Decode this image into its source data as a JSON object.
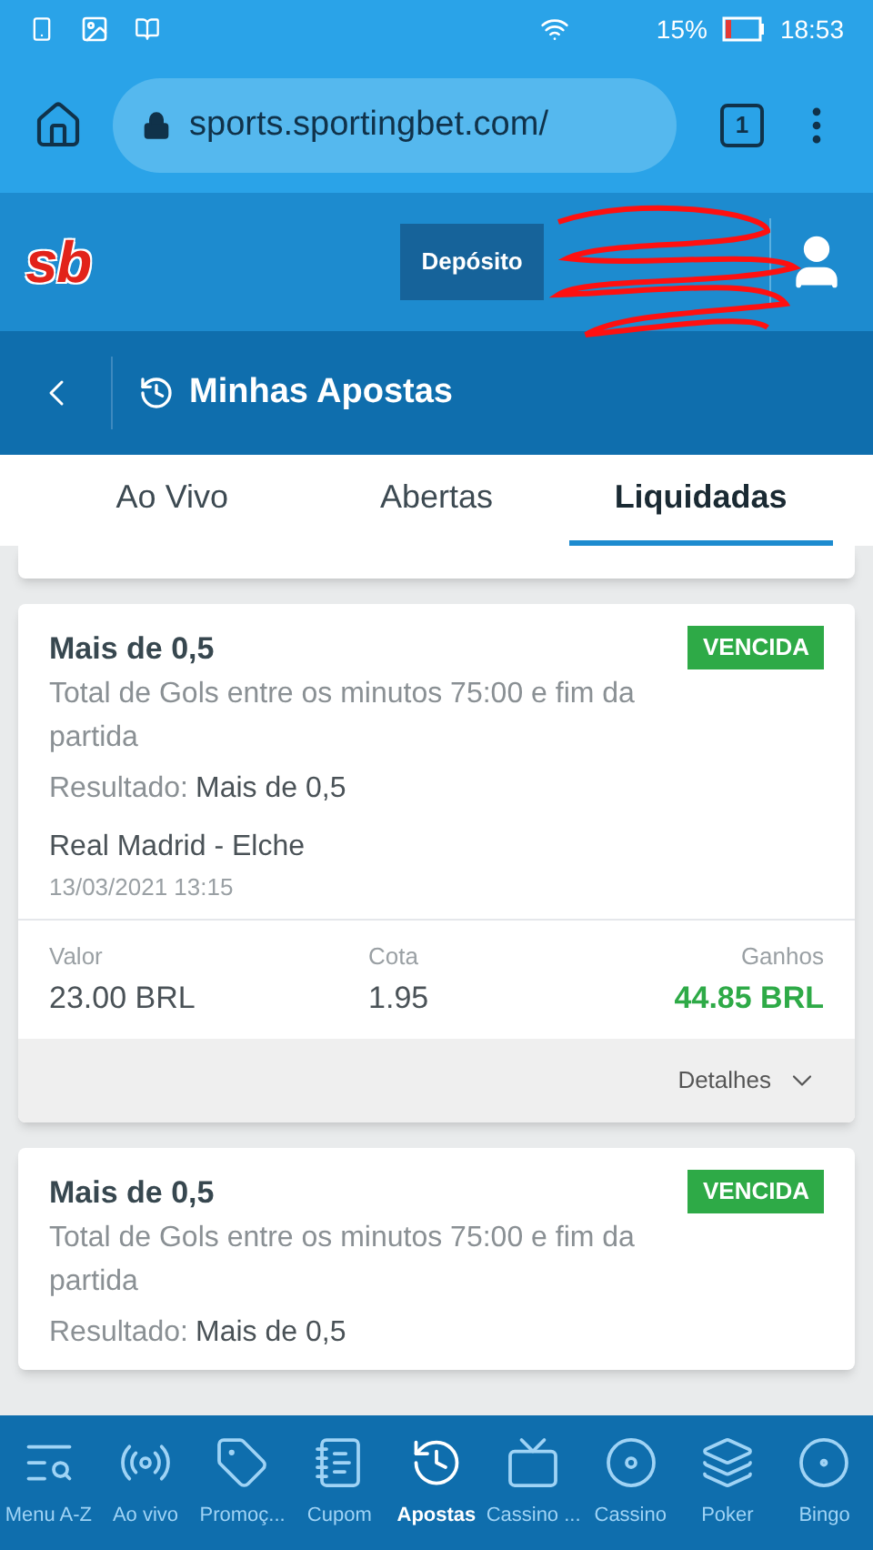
{
  "status_bar": {
    "battery": "15%",
    "time": "18:53"
  },
  "browser": {
    "url": "sports.sportingbet.com/",
    "tab_count": "1"
  },
  "header": {
    "logo": "sb",
    "deposit_button": "Depósito"
  },
  "page_title": "Minhas Apostas",
  "tabs": [
    {
      "label": "Ao Vivo",
      "selected": false
    },
    {
      "label": "Abertas",
      "selected": false
    },
    {
      "label": "Liquidadas",
      "selected": true
    }
  ],
  "bets": [
    {
      "selection": "Mais de 0,5",
      "status": "VENCIDA",
      "market": "Total de Gols entre os minutos 75:00 e fim da partida",
      "result_label": "Resultado:",
      "result": "Mais de 0,5",
      "event": "Real Madrid - Elche",
      "date": "13/03/2021 13:15",
      "stake_label": "Valor",
      "stake": "23.00 BRL",
      "odds_label": "Cota",
      "odds": "1.95",
      "winnings_label": "Ganhos",
      "winnings": "44.85 BRL",
      "details": "Detalhes"
    },
    {
      "selection": "Mais de 0,5",
      "status": "VENCIDA",
      "market": "Total de Gols entre os minutos 75:00 e fim da partida",
      "result_label": "Resultado:",
      "result": "Mais de 0,5"
    }
  ],
  "bottom_nav": [
    {
      "label": "Menu A-Z",
      "selected": false
    },
    {
      "label": "Ao vivo",
      "selected": false
    },
    {
      "label": "Promoç...",
      "selected": false
    },
    {
      "label": "Cupom",
      "selected": false
    },
    {
      "label": "Apostas",
      "selected": true
    },
    {
      "label": "Cassino ...",
      "selected": false
    },
    {
      "label": "Cassino",
      "selected": false
    },
    {
      "label": "Poker",
      "selected": false
    },
    {
      "label": "Bingo",
      "selected": false
    }
  ]
}
